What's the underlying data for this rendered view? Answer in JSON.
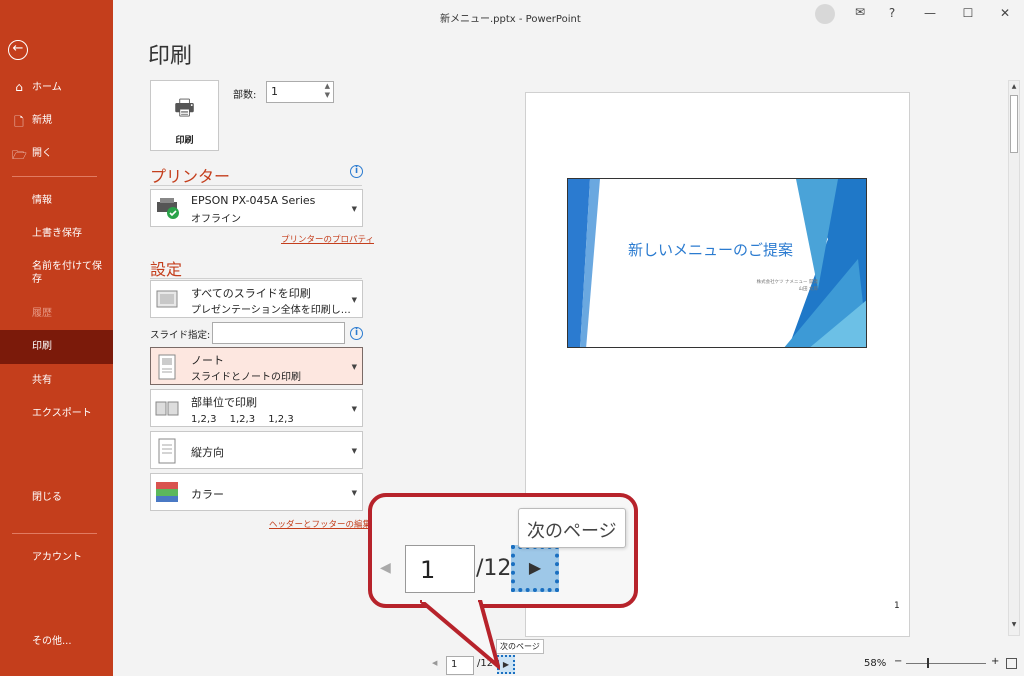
{
  "window": {
    "title": "新メニュー.pptx  -  PowerPoint",
    "help": "?",
    "minimize": "—",
    "maximize": "☐",
    "close": "✕"
  },
  "sidebar": {
    "back": "←",
    "items": [
      {
        "label": "ホーム"
      },
      {
        "label": "新規"
      },
      {
        "label": "開く"
      },
      {
        "label": "情報"
      },
      {
        "label": "上書き保存"
      },
      {
        "label": "名前を付けて保存"
      },
      {
        "label": "履歴"
      },
      {
        "label": "印刷"
      },
      {
        "label": "共有"
      },
      {
        "label": "エクスポート"
      },
      {
        "label": "閉じる"
      },
      {
        "label": "アカウント"
      },
      {
        "label": "その他..."
      }
    ]
  },
  "main": {
    "title": "印刷",
    "print_button": "印刷",
    "copies_label": "部数:",
    "copies_value": "1",
    "printer_section": "プリンター",
    "printer_name": "EPSON PX-045A Series",
    "printer_status": "オフライン",
    "printer_properties": "プリンターのプロパティ",
    "settings_section": "設定",
    "range_title": "すべてのスライドを印刷",
    "range_desc": "プレゼンテーション全体を印刷し…",
    "slides_label": "スライド指定:",
    "layout_title": "ノート",
    "layout_desc": "スライドとノートの印刷",
    "collate_title": "部単位で印刷",
    "collate_desc": "1,2,3　 1,2,3　 1,2,3",
    "orientation": "縦方向",
    "color": "カラー",
    "header_footer_link": "ヘッダーとフッターの編集"
  },
  "preview": {
    "slide_title": "新しいメニューのご提案",
    "slide_sub1": "株式会社ケツ ナメニュー 開発",
    "slide_sub2": "山田 太郎",
    "page_number": "1",
    "current_page": "1",
    "total_pages": "/12",
    "zoom": "58%",
    "zoom_minus": "−",
    "zoom_plus": "+"
  },
  "tooltip": {
    "next_page": "次のページ"
  },
  "colors": {
    "accent": "#c43e1c",
    "sidebar_active": "#7b1a0a",
    "callout_border": "#b7232b",
    "link_blue": "#2b7bd0"
  }
}
